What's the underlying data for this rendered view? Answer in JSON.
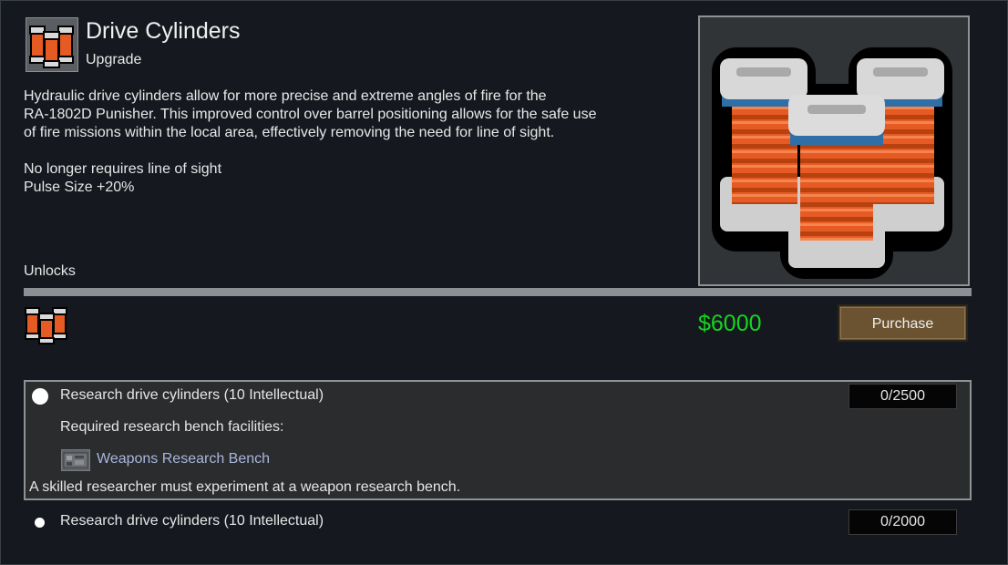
{
  "header": {
    "title": "Drive Cylinders",
    "subtitle": "Upgrade"
  },
  "description": {
    "line1": "Hydraulic drive cylinders allow for more precise and extreme angles of fire for the",
    "line2": "RA-1802D Punisher. This improved control over barrel positioning allows for the safe use",
    "line3": "of fire missions within the local area, effectively removing the need for line of sight."
  },
  "effects": [
    "No longer requires line of sight",
    "Pulse Size +20%"
  ],
  "unlocks_label": "Unlocks",
  "price": "$6000",
  "purchase_label": "Purchase",
  "research": [
    {
      "label": "Research drive cylinders (10 Intellectual)",
      "progress": "0/2500",
      "requirement": "Required research bench facilities:",
      "facility": "Weapons Research Bench",
      "note": "A skilled researcher must experiment at a weapon research bench."
    },
    {
      "label": "Research drive cylinders (10 Intellectual)",
      "progress": "0/2000"
    }
  ],
  "colors": {
    "price": "#14d61e",
    "link": "#a9b6dc",
    "cylinder": "#e65a24",
    "accent_blue": "#2f6fa8",
    "button": "#6b5331"
  },
  "icons": {
    "header": "drive-cylinders-icon",
    "preview": "drive-cylinders-icon",
    "unlock": "drive-cylinders-icon",
    "facility": "research-bench-icon"
  }
}
